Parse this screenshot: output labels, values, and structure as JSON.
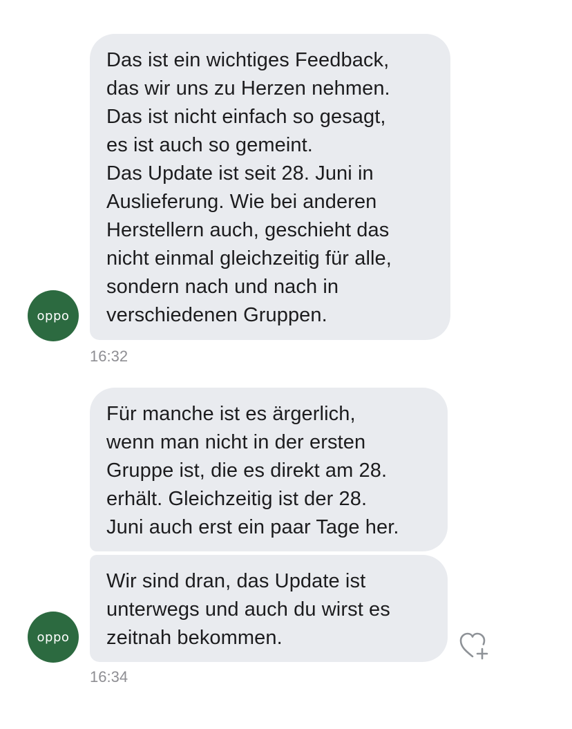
{
  "messages": [
    {
      "sender": "oppo",
      "text": "Das ist ein wichtiges Feedback,\ndas wir uns zu Herzen nehmen.\nDas ist nicht einfach so gesagt,\nes ist auch so gemeint.\nDas Update ist seit 28. Juni in\nAuslieferung. Wie bei anderen\nHerstellern auch, geschieht das\nnicht einmal gleichzeitig für alle,\nsondern nach und nach in\nverschiedenen Gruppen."
    },
    {
      "sender": "oppo",
      "text": "Für manche ist es ärgerlich,\nwenn man nicht in der ersten\nGruppe ist, die es direkt am 28.\nerhält. Gleichzeitig ist der 28.\nJuni auch erst ein paar Tage her."
    },
    {
      "sender": "oppo",
      "text": "Wir sind dran, das Update ist\nunterwegs und auch du wirst es\nzeitnah bekommen."
    }
  ],
  "avatar": {
    "label": "oppo",
    "color": "#2c6a40"
  },
  "timestamps": [
    "16:32",
    "16:34"
  ],
  "icons": {
    "reaction": "heart-plus-icon"
  },
  "colors": {
    "bubble": "#e9ebef",
    "timestamp": "#8e8e93",
    "text": "#1c1c1e"
  }
}
